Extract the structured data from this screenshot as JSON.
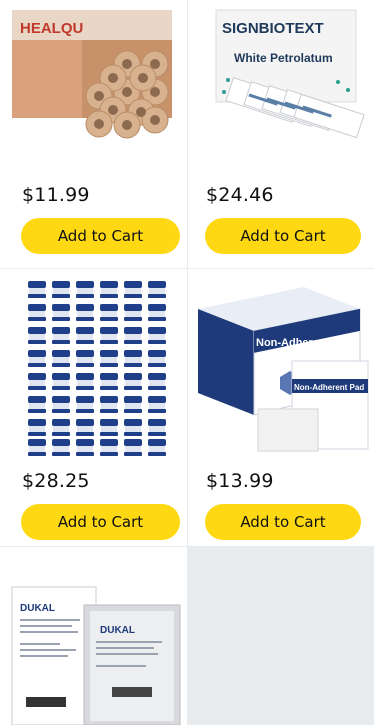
{
  "products": [
    {
      "image": "self-adhesive-bandage-wrap-rolls",
      "brand_text": "HEALQU",
      "price": "$11.99",
      "button_label": "Add to Cart"
    },
    {
      "image": "white-petrolatum-packets",
      "brand_text": "SIGNBIOTEXT",
      "subtitle": "White Petrolatum",
      "price": "$24.46",
      "button_label": "Add to Cart"
    },
    {
      "image": "petroleum-jelly-mini-jars",
      "price": "$28.25",
      "button_label": "Add to Cart"
    },
    {
      "image": "non-adherent-pads-box",
      "box_text": "Non-Adherent Pads",
      "pad_text": "Non-Adherent Pad",
      "price": "$13.99",
      "button_label": "Add to Cart"
    },
    {
      "image": "petrolatum-gauze-dressing-packets",
      "brand_text": "DUKAL"
    }
  ]
}
